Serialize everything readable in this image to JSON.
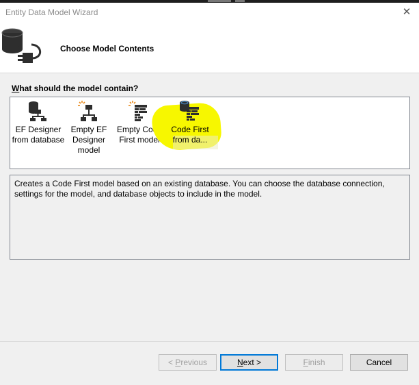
{
  "window": {
    "title": "Entity Data Model Wizard"
  },
  "header": {
    "title": "Choose Model Contents"
  },
  "question": {
    "accel": "W",
    "rest": "hat should the model contain?"
  },
  "options": [
    {
      "label": "EF Designer from database",
      "icon": "ef-designer-database-icon"
    },
    {
      "label": "Empty EF Designer model",
      "icon": "empty-ef-designer-icon"
    },
    {
      "label": "Empty Code First model",
      "icon": "empty-code-first-icon"
    },
    {
      "label": "Code First from da...",
      "icon": "code-first-database-icon",
      "selected": true
    }
  ],
  "description": "Creates a Code First model based on an existing database. You can choose the database connection, settings for the model, and database objects to include in the model.",
  "buttons": {
    "previous": {
      "pre": "< ",
      "accel": "P",
      "rest": "revious"
    },
    "next": {
      "accel": "N",
      "rest": "ext >"
    },
    "finish": {
      "accel": "F",
      "rest": "inish"
    },
    "cancel": "Cancel"
  },
  "colors": {
    "highlight": "#f7f700",
    "accent": "#0078d7"
  }
}
